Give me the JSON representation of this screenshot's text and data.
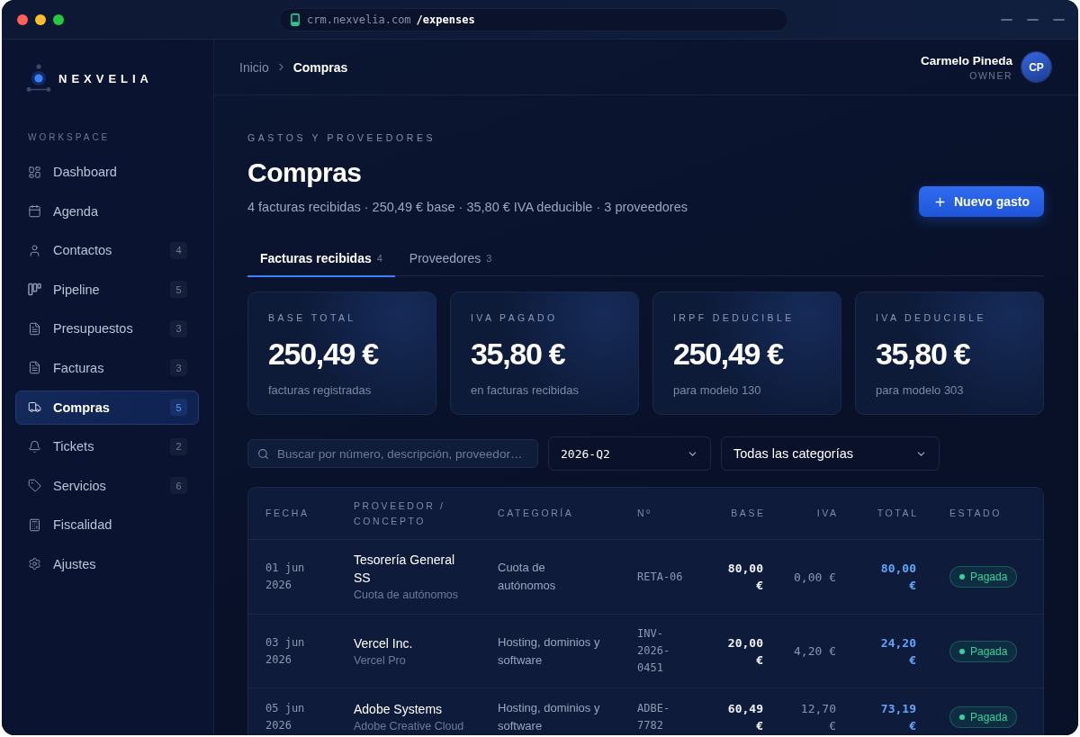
{
  "window": {
    "url_host": "crm.nexvelia.com",
    "url_path": "/expenses"
  },
  "sidebar": {
    "brand": "NEXVELIA",
    "section": "WORKSPACE",
    "items": [
      {
        "label": "Dashboard",
        "selected": false
      },
      {
        "label": "Agenda",
        "selected": false
      },
      {
        "label": "Contactos",
        "count": "4",
        "selected": false
      },
      {
        "label": "Pipeline",
        "count": "5",
        "selected": false
      },
      {
        "label": "Presupuestos",
        "count": "3",
        "selected": false
      },
      {
        "label": "Facturas",
        "count": "3",
        "selected": false
      },
      {
        "label": "Compras",
        "count": "5",
        "selected": true
      },
      {
        "label": "Tickets",
        "count": "2",
        "selected": false
      },
      {
        "label": "Servicios",
        "count": "6",
        "selected": false
      },
      {
        "label": "Fiscalidad",
        "selected": false
      },
      {
        "label": "Ajustes",
        "selected": false
      }
    ]
  },
  "header": {
    "breadcrumb": [
      {
        "label": "Inicio",
        "current": false
      },
      {
        "label": "Compras",
        "current": true
      }
    ],
    "user": {
      "name": "Carmelo Pineda",
      "role": "OWNER",
      "initials": "CP"
    }
  },
  "page": {
    "eyebrow": "GASTOS Y PROVEEDORES",
    "title": "Compras",
    "summary": "4 facturas recibidas · 250,49 € base · 35,80 € IVA deducible · 3 proveedores",
    "new_button": "Nuevo gasto"
  },
  "tabs": [
    {
      "label": "Facturas recibidas",
      "count": "4",
      "selected": true
    },
    {
      "label": "Proveedores",
      "count": "3",
      "selected": false
    }
  ],
  "stats": [
    {
      "label": "BASE TOTAL",
      "value": "250,49 €",
      "note": "facturas registradas"
    },
    {
      "label": "IVA PAGADO",
      "value": "35,80 €",
      "note": "en facturas recibidas"
    },
    {
      "label": "IRPF DEDUCIBLE",
      "value": "250,49 €",
      "note": "para modelo 130"
    },
    {
      "label": "IVA DEDUCIBLE",
      "value": "35,80 €",
      "note": "para modelo 303"
    }
  ],
  "filters": {
    "search": {
      "placeholder": "Buscar por número, descripción, proveedor…"
    },
    "period": "2026-Q2",
    "category": "Todas las categorías"
  },
  "table": {
    "columns": [
      "FECHA",
      "PROVEEDOR / CONCEPTO",
      "CATEGORÍA",
      "Nº",
      "BASE",
      "IVA",
      "TOTAL",
      "ESTADO"
    ],
    "rows": [
      {
        "date": "01 jun 2026",
        "supplier": "Tesorería General SS",
        "concept": "Cuota de autónomos",
        "category": "Cuota de autónomos",
        "number": "RETA-06",
        "base": "80,00 €",
        "vat": "0,00 €",
        "total": "80,00 €",
        "status": {
          "label": "Pagada",
          "kind": "paid"
        }
      },
      {
        "date": "03 jun 2026",
        "supplier": "Vercel Inc.",
        "concept": "Vercel Pro",
        "category": "Hosting, dominios y software",
        "number": "INV-2026-0451",
        "base": "20,00 €",
        "vat": "4,20 €",
        "total": "24,20 €",
        "status": {
          "label": "Pagada",
          "kind": "paid"
        }
      },
      {
        "date": "05 jun 2026",
        "supplier": "Adobe Systems",
        "concept": "Adobe Creative Cloud",
        "category": "Hosting, dominios y software",
        "number": "ADBE-7782",
        "base": "60,49 €",
        "vat": "12,70 €",
        "total": "73,19 €",
        "status": {
          "label": "Pagada",
          "kind": "paid"
        }
      }
    ]
  }
}
